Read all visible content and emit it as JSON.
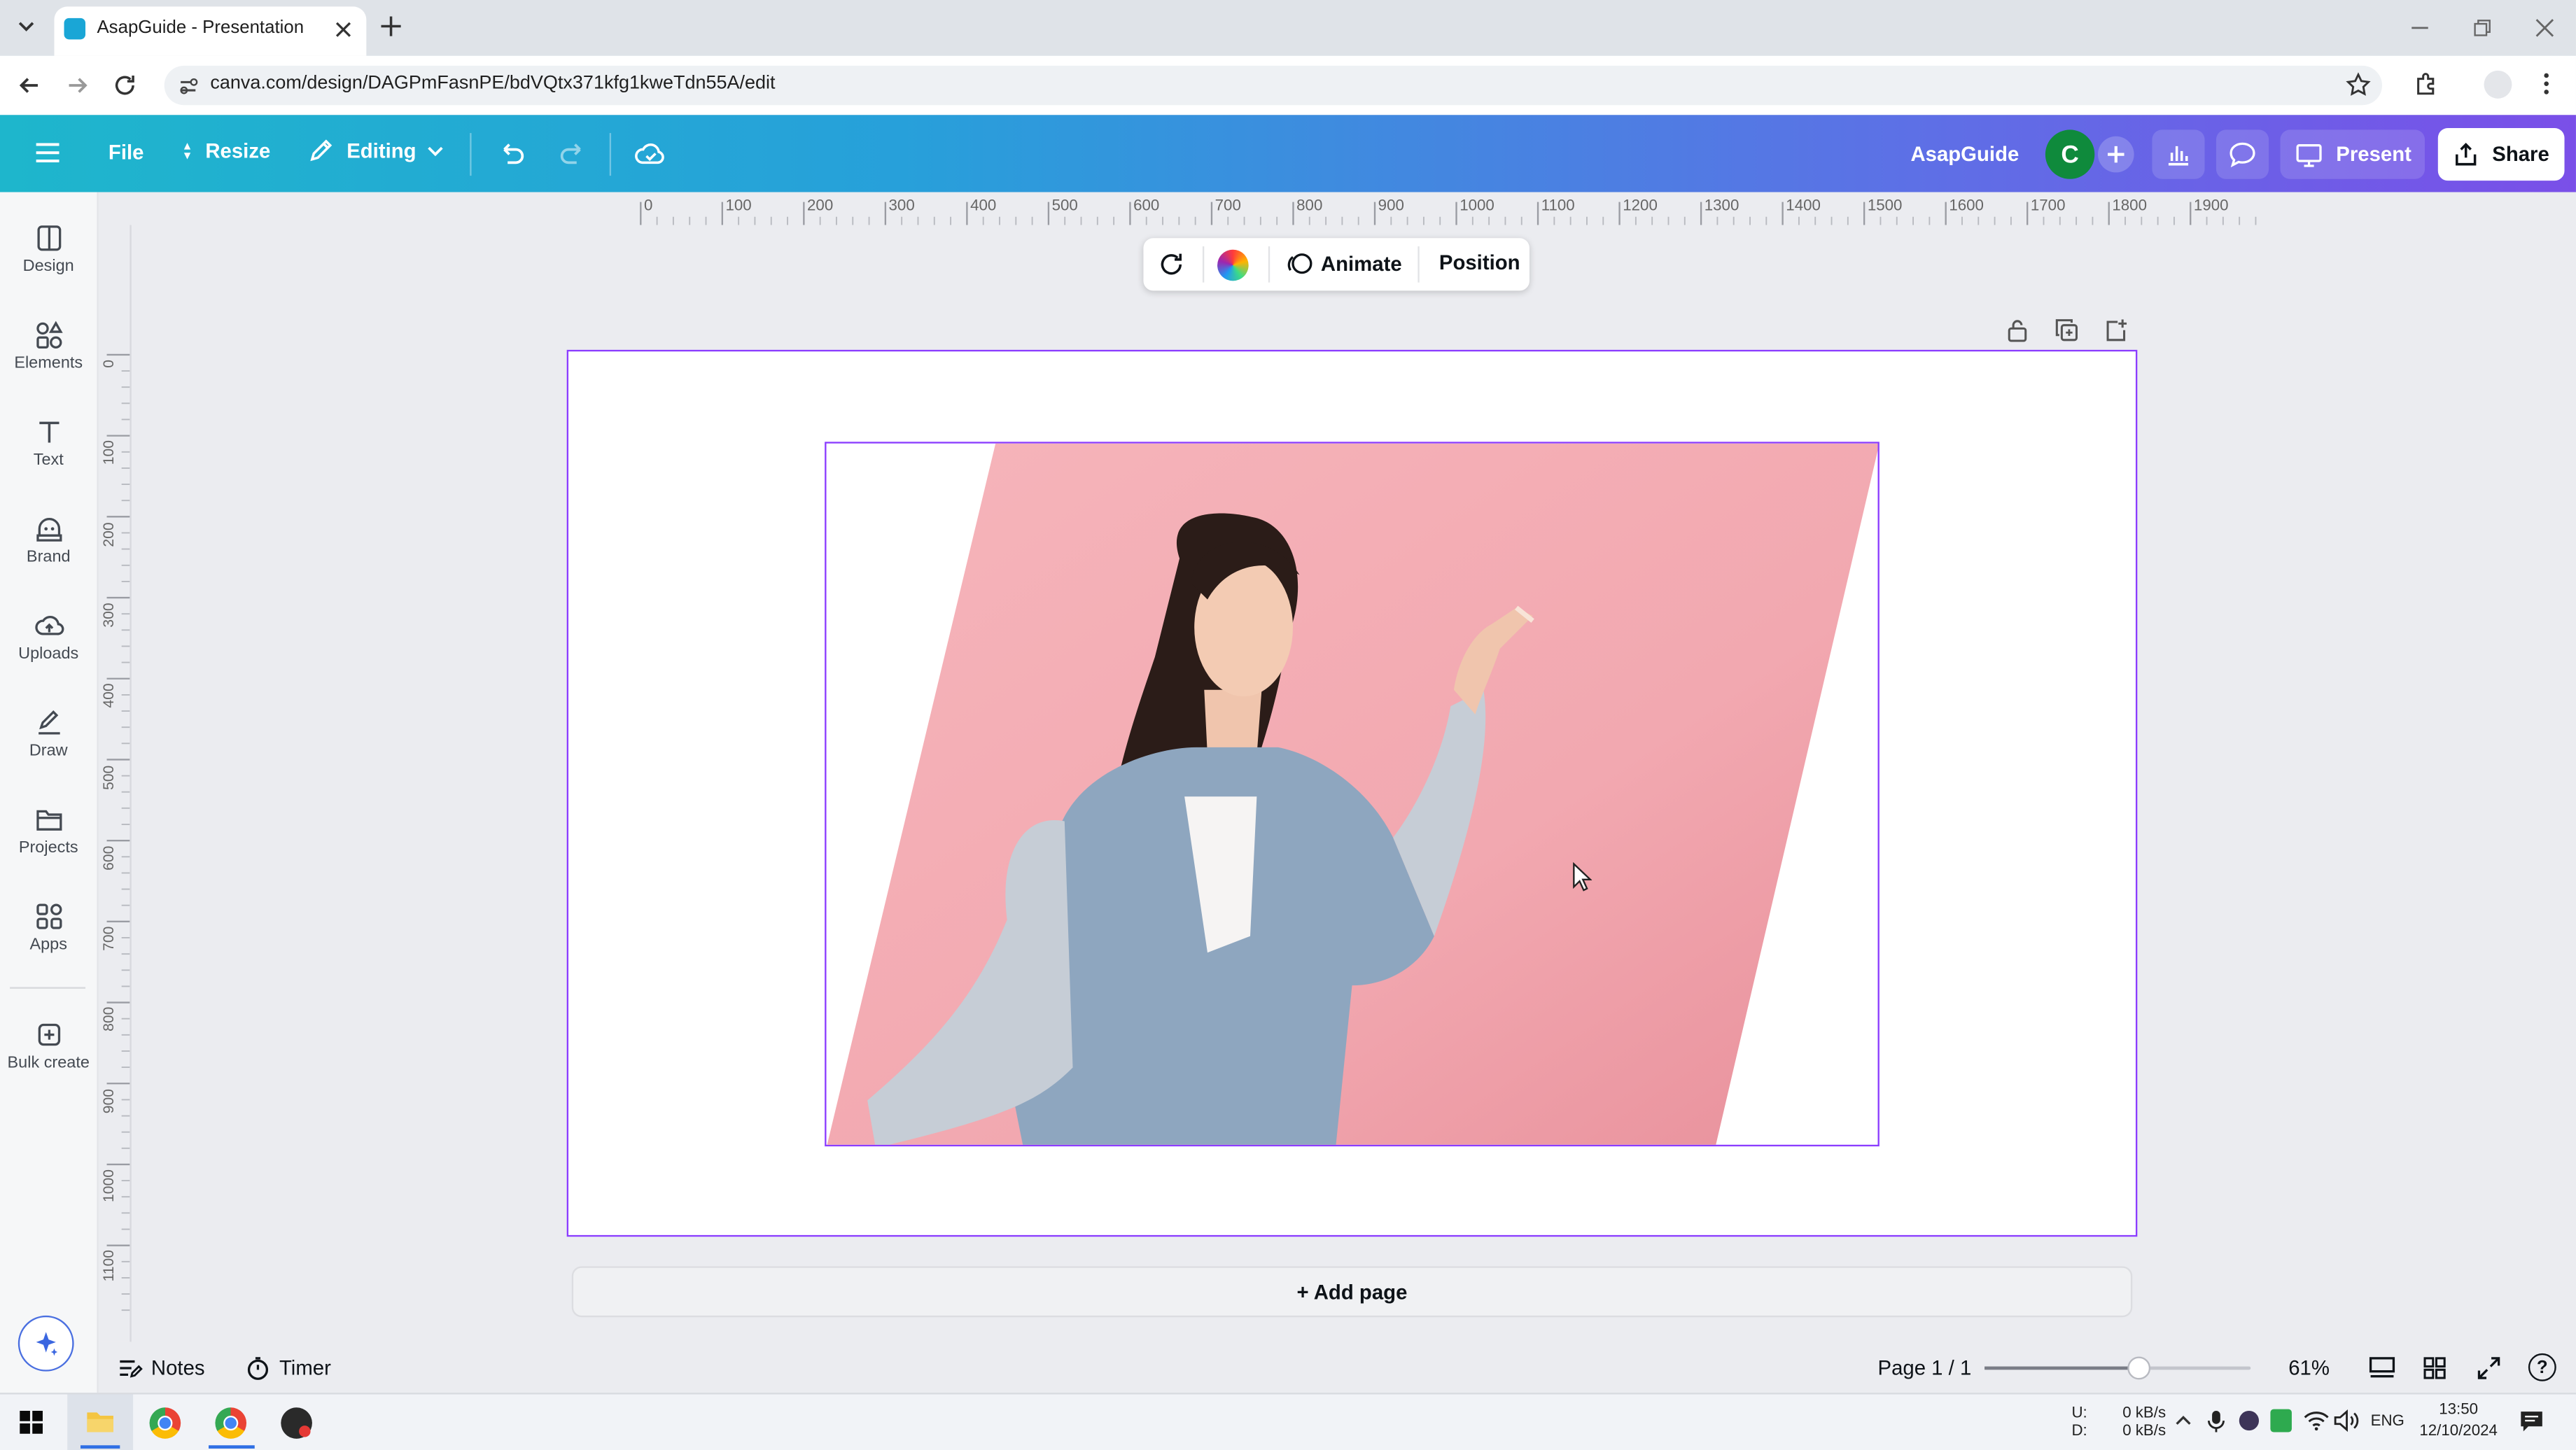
{
  "browser": {
    "tab_title": "AsapGuide - Presentation",
    "url": "canva.com/design/DAGPmFasnPE/bdVQtx371kfg1kweTdn55A/edit"
  },
  "toolbar": {
    "file_label": "File",
    "resize_label": "Resize",
    "editing_label": "Editing",
    "team_name": "AsapGuide",
    "avatar_letter": "C",
    "present_label": "Present",
    "share_label": "Share"
  },
  "sidebar": {
    "items": [
      {
        "label": "Design",
        "icon": "design-icon"
      },
      {
        "label": "Elements",
        "icon": "elements-icon"
      },
      {
        "label": "Text",
        "icon": "text-icon"
      },
      {
        "label": "Brand",
        "icon": "brand-icon"
      },
      {
        "label": "Uploads",
        "icon": "uploads-icon"
      },
      {
        "label": "Draw",
        "icon": "draw-icon"
      },
      {
        "label": "Projects",
        "icon": "projects-icon"
      },
      {
        "label": "Apps",
        "icon": "apps-icon"
      },
      {
        "label": "Bulk create",
        "icon": "bulk-create-icon"
      }
    ]
  },
  "ruler": {
    "horizontal": [
      "0",
      "100",
      "200",
      "300",
      "400",
      "500",
      "600",
      "700",
      "800",
      "900",
      "1000",
      "1100",
      "1200",
      "1300",
      "1400",
      "1500",
      "1600",
      "1700",
      "1800",
      "1900"
    ],
    "vertical": [
      "0",
      "100",
      "200",
      "300",
      "400",
      "500",
      "600",
      "700",
      "800",
      "900",
      "1000",
      "1100"
    ]
  },
  "context_toolbar": {
    "animate_label": "Animate",
    "position_label": "Position"
  },
  "canvas": {
    "add_page_label": "+ Add page"
  },
  "bottom_bar": {
    "notes_label": "Notes",
    "timer_label": "Timer",
    "page_indicator": "Page 1 / 1",
    "zoom_level": "61%",
    "zoom_fraction": 0.58
  },
  "taskbar": {
    "net_up_label": "U:",
    "net_down_label": "D:",
    "net_up": "0 kB/s",
    "net_down": "0 kB/s",
    "language": "ENG",
    "time": "13:50",
    "date": "12/10/2024"
  },
  "colors": {
    "accent": "#8b3dff",
    "toolbar_gradient_start": "#1eb6cc",
    "toolbar_gradient_end": "#7a4fe8",
    "photo_background": "#f1a8b0"
  }
}
